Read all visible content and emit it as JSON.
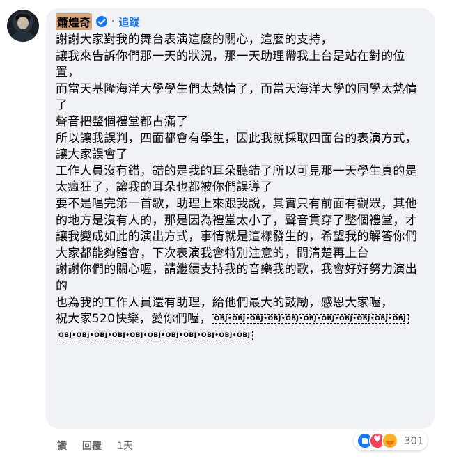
{
  "comment": {
    "author": "蕭煌奇",
    "separator": "·",
    "follow_label": "追蹤",
    "lines": [
      "謝謝大家對我的舞台表演這麼的關心，這麼的支持，",
      "讓我來告訴你們那一天的狀況，那一天助理帶我上台是站在對的位置，",
      "而當天基隆海洋大學學生們太熱情了，而當天海洋大學的同學太熱情了",
      "聲音把整個禮堂都占滿了",
      "所以讓我誤判，四面都會有學生，因此我就採取四面台的表演方式，讓大家誤會了",
      "工作人員沒有錯，錯的是我的耳朵聽錯了所以可見那一天學生真的是太瘋狂了，讓我的耳朵也都被你們誤導了",
      "要不是唱完第一首歌，助理上來跟我說，其實只有前面有觀眾，其他的地方是沒有人的，那是因為禮堂太小了，聲音貫穿了整個禮堂，才讓我變成如此的演出方式，事情就是這樣發生的，希望我的解答你們大家都能夠體會，下次表演我會特別注意的，問清楚再上台",
      "謝謝你們的關心喔，請繼續支持我的音樂我的歌，我會好好努力演出的",
      "也為我的工作人員還有助理，給他們最大的鼓勵，感恩大家喔，"
    ],
    "last_line": "祝大家520快樂，愛你們喔，",
    "obj_label": "OBJ",
    "obj_row1_count": 11,
    "obj_row2_count": 11
  },
  "actions": {
    "like_label": "讚",
    "reply_label": "回覆",
    "time": "1天"
  },
  "reactions": {
    "types": [
      "like",
      "love",
      "care"
    ],
    "count": "301"
  }
}
